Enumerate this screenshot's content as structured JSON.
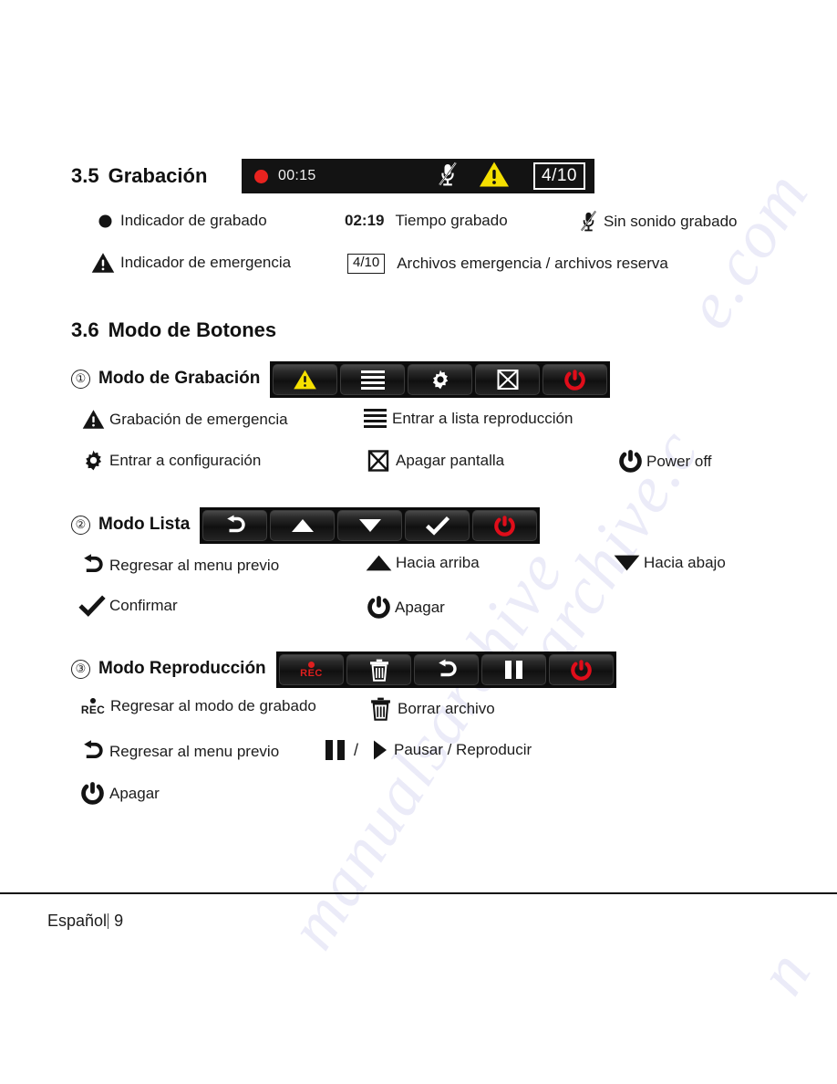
{
  "watermark": {
    "fragments": [
      "e.com",
      "archive.c",
      "manualsarchive",
      "n"
    ]
  },
  "sections": {
    "recording": {
      "number": "3.5",
      "title": "Grabación",
      "statusbar": {
        "record_dot_icon": "record-dot-icon",
        "time": "00:15",
        "mic_muted_icon": "microphone-muted-icon",
        "warning_icon": "warning-triangle-icon",
        "file_count": "4/10"
      },
      "legend": [
        {
          "icon": "record-dot-icon",
          "label": "Indicador de grabado",
          "bold": false
        },
        {
          "icon": "text-time",
          "label": "02:19",
          "label2": "Tiempo  grabado",
          "bold": true
        },
        {
          "icon": "microphone-muted-icon",
          "label": "Sin sonido grabado",
          "bold": false
        },
        {
          "icon": "warning-triangle-icon",
          "label": "Indicador de emergencia",
          "bold": false
        },
        {
          "icon": "boxed-count",
          "label": "4/10",
          "label2": "Archivos emergencia / archivos reserva",
          "bold": false
        }
      ]
    },
    "buttons": {
      "number": "3.6",
      "title": "Modo de Botones",
      "modes": [
        {
          "index": "①",
          "name": "Modo de Grabación",
          "bar": [
            {
              "icon": "warning-triangle-icon"
            },
            {
              "icon": "list-lines-icon"
            },
            {
              "icon": "gear-icon"
            },
            {
              "icon": "screen-off-icon"
            },
            {
              "icon": "power-icon"
            }
          ],
          "legend": [
            {
              "icon": "warning-triangle-icon",
              "label": "Grabación de emergencia"
            },
            {
              "icon": "list-lines-icon",
              "label": "Entrar a lista reproducción"
            },
            {
              "icon": "gear-icon",
              "label": "Entrar a configuración"
            },
            {
              "icon": "screen-off-icon",
              "label": "Apagar pantalla"
            },
            {
              "icon": "power-icon",
              "label": "Power off"
            }
          ]
        },
        {
          "index": "②",
          "name": "Modo Lista",
          "bar": [
            {
              "icon": "return-arrow-icon"
            },
            {
              "icon": "triangle-up-icon"
            },
            {
              "icon": "triangle-down-icon"
            },
            {
              "icon": "check-icon"
            },
            {
              "icon": "power-icon"
            }
          ],
          "legend": [
            {
              "icon": "return-arrow-icon",
              "label": "Regresar al menu previo"
            },
            {
              "icon": "triangle-up-icon",
              "label": "Hacia arriba"
            },
            {
              "icon": "triangle-down-icon",
              "label": "Hacia abajo"
            },
            {
              "icon": "check-icon",
              "label": "Confirmar"
            },
            {
              "icon": "power-icon",
              "label": "Apagar"
            }
          ]
        },
        {
          "index": "③",
          "name": "Modo Reproducción",
          "bar": [
            {
              "icon": "rec-icon",
              "label": "REC"
            },
            {
              "icon": "trash-icon"
            },
            {
              "icon": "return-arrow-icon"
            },
            {
              "icon": "pause-icon"
            },
            {
              "icon": "power-icon"
            }
          ],
          "legend": [
            {
              "icon": "rec-icon",
              "label": "Regresar al modo de grabado",
              "icon_text": "REC"
            },
            {
              "icon": "trash-icon",
              "label": "Borrar archivo"
            },
            {
              "icon": "return-arrow-icon",
              "label": "Regresar al menu previo"
            },
            {
              "icon": "pause-play-icon",
              "label": "Pausar / Reproducir",
              "separator": "/"
            },
            {
              "icon": "power-icon",
              "label": "Apagar"
            }
          ]
        }
      ]
    }
  },
  "footer": {
    "language": "Español",
    "page_number": "9"
  },
  "colors": {
    "warning_yellow": "#f5e000",
    "record_red": "#e8231f",
    "power_red": "#e00d1a",
    "bar_black": "#0c0c0c"
  }
}
